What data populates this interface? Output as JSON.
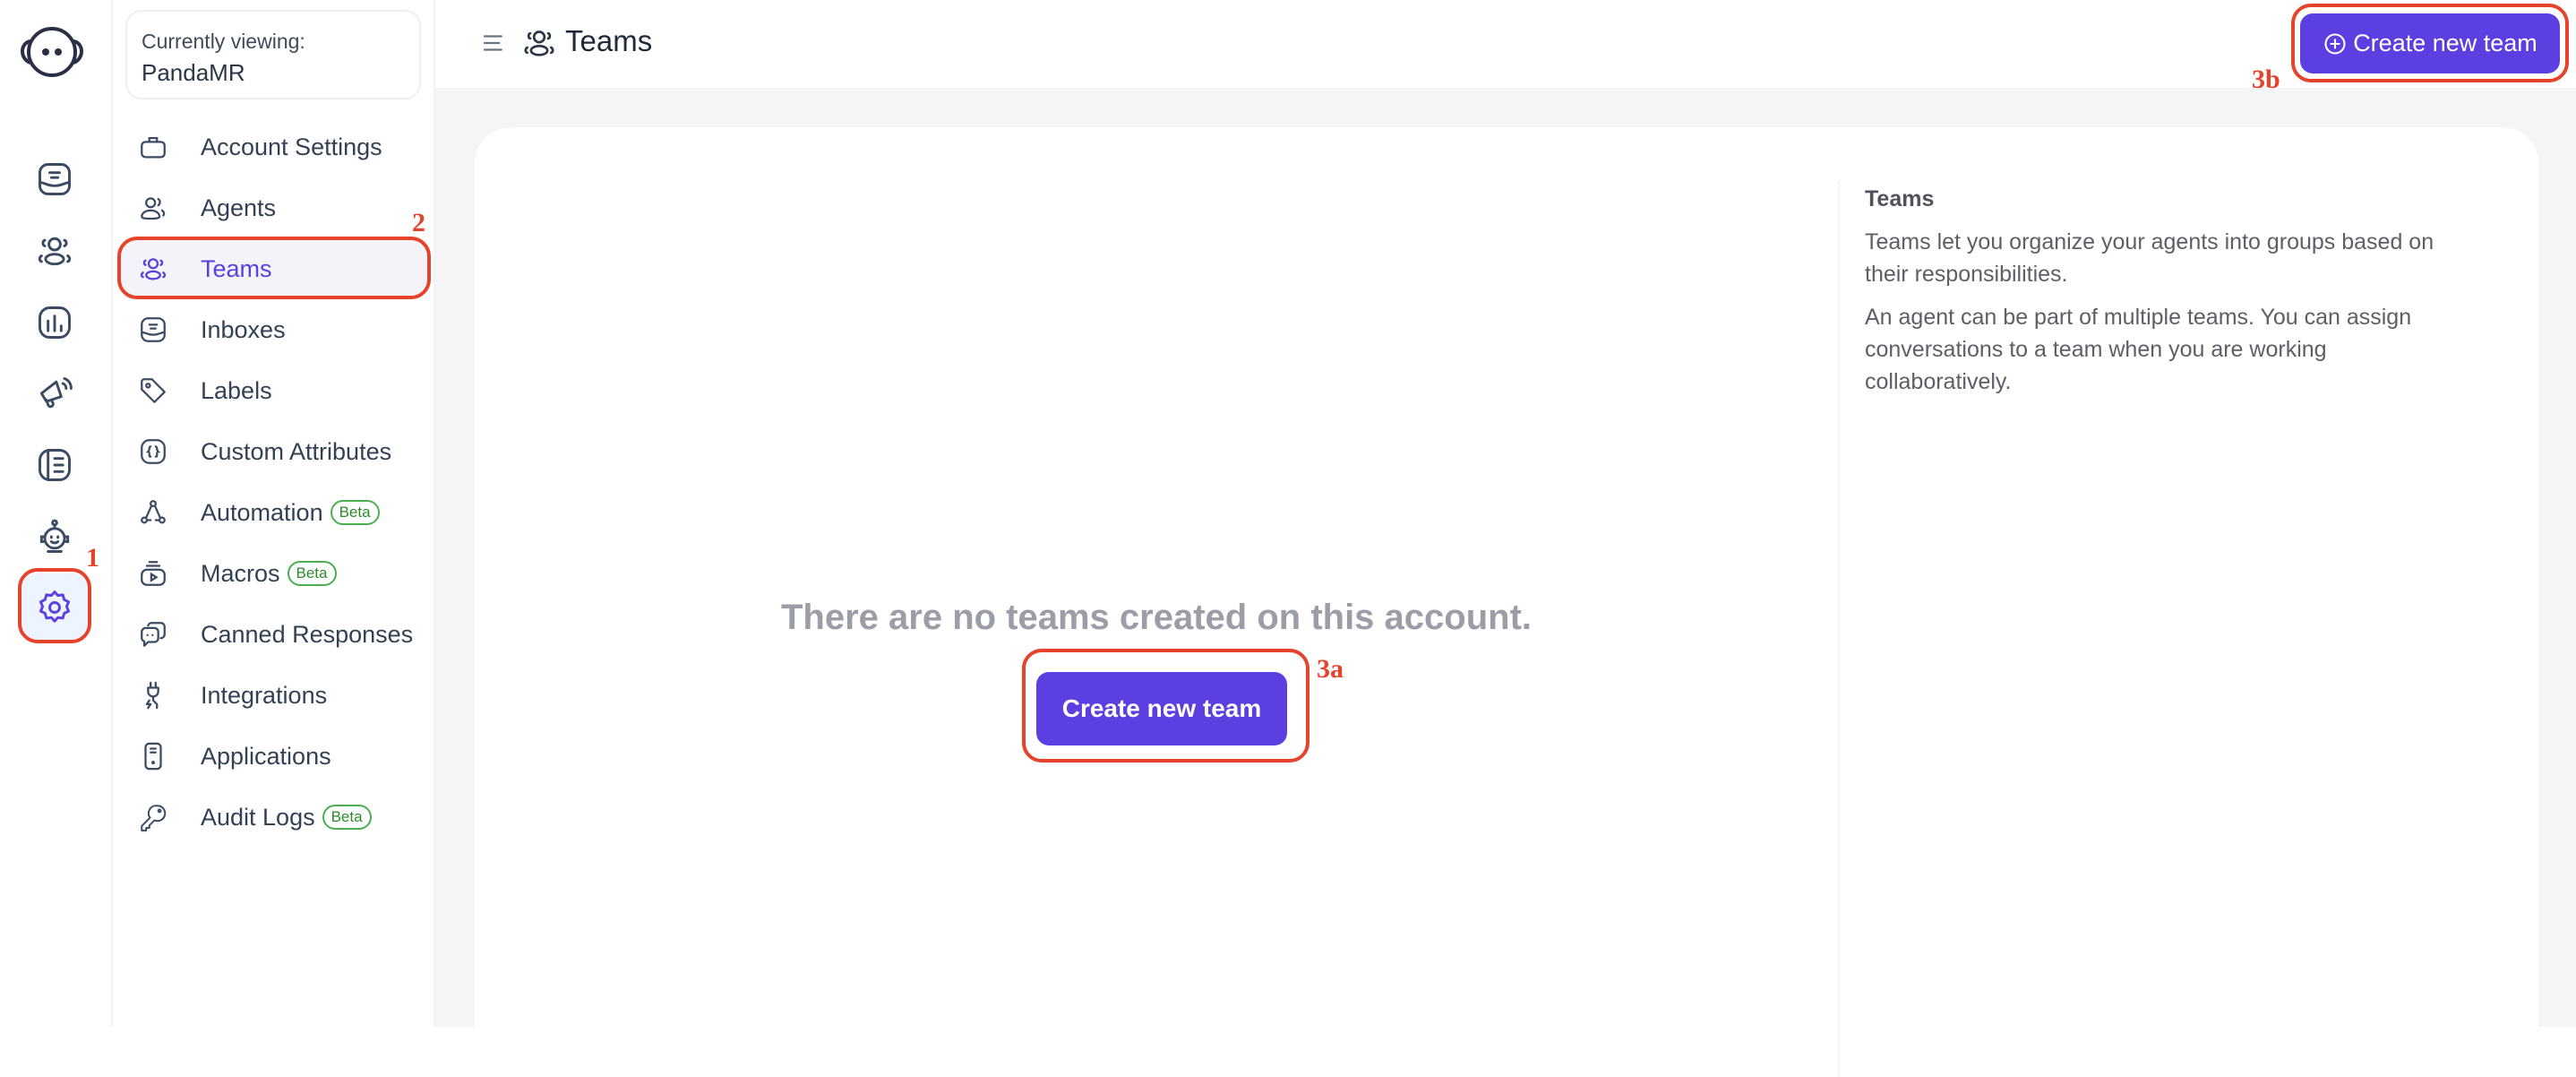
{
  "rail": {
    "logo": "chatwoot-logo",
    "items": [
      {
        "name": "conversations",
        "icon": "inbox-icon"
      },
      {
        "name": "contacts",
        "icon": "contacts-icon"
      },
      {
        "name": "reports",
        "icon": "reports-icon"
      },
      {
        "name": "campaigns",
        "icon": "megaphone-icon"
      },
      {
        "name": "help-center",
        "icon": "library-icon"
      },
      {
        "name": "captain",
        "icon": "bot-icon"
      },
      {
        "name": "settings",
        "icon": "gear-icon",
        "active": true
      }
    ]
  },
  "account": {
    "label": "Currently viewing:",
    "name": "PandaMR"
  },
  "sidebar": {
    "items": [
      {
        "label": "Account Settings",
        "icon": "briefcase-icon"
      },
      {
        "label": "Agents",
        "icon": "agents-icon"
      },
      {
        "label": "Teams",
        "icon": "teams-icon",
        "active": true
      },
      {
        "label": "Inboxes",
        "icon": "inbox-icon"
      },
      {
        "label": "Labels",
        "icon": "tag-icon"
      },
      {
        "label": "Custom Attributes",
        "icon": "braces-icon"
      },
      {
        "label": "Automation",
        "icon": "automation-icon",
        "badge": "Beta"
      },
      {
        "label": "Macros",
        "icon": "macros-icon",
        "badge": "Beta"
      },
      {
        "label": "Canned Responses",
        "icon": "chat-bubbles-icon"
      },
      {
        "label": "Integrations",
        "icon": "plug-icon"
      },
      {
        "label": "Applications",
        "icon": "app-icon"
      },
      {
        "label": "Audit Logs",
        "icon": "key-icon",
        "badge": "Beta"
      }
    ]
  },
  "header": {
    "title": "Teams",
    "create_button": "Create new team"
  },
  "content": {
    "empty_message": "There are no teams created on this account.",
    "create_button": "Create new team",
    "info_title": "Teams",
    "info_paragraphs": [
      "Teams let you organize your agents into groups based on their responsibilities.",
      "An agent can be part of multiple teams. You can assign conversations to a team when you are working collaboratively."
    ]
  },
  "annotations": {
    "settings": "1",
    "teams": "2",
    "center_button": "3a",
    "top_button": "3b"
  },
  "colors": {
    "accent": "#5b3fe0",
    "annotation": "#e5432b",
    "beta": "#2e8b2e",
    "text": "#334155"
  }
}
